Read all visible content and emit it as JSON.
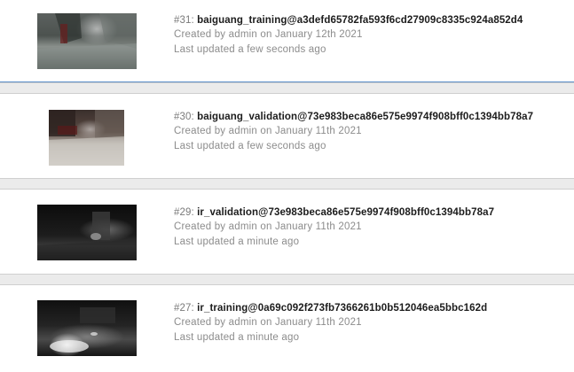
{
  "jobs": [
    {
      "number": "#31:",
      "name": "baiguang_training@a3defd65782fa593f6cd27909c8335c924a852d4",
      "created": "Created by admin on January 12th 2021",
      "updated": "Last updated a few seconds ago",
      "thumbnail_icon": "robot-camera-frame-hallway"
    },
    {
      "number": "#30:",
      "name": "baiguang_validation@73e983beca86e575e9974f908bff0c1394bb78a7",
      "created": "Created by admin on January 11th 2021",
      "updated": "Last updated a few seconds ago",
      "thumbnail_icon": "robot-camera-frame-room"
    },
    {
      "number": "#29:",
      "name": "ir_validation@73e983beca86e575e9974f908bff0c1394bb78a7",
      "created": "Created by admin on January 11th 2021",
      "updated": "Last updated a minute ago",
      "thumbnail_icon": "infrared-camera-frame"
    },
    {
      "number": "#27:",
      "name": "ir_training@0a69c092f273fb7366261b0b512046ea5bbc162d",
      "created": "Created by admin on January 11th 2021",
      "updated": "Last updated a minute ago",
      "thumbnail_icon": "infrared-camera-frame"
    }
  ],
  "colors": {
    "divider_background": "#ebebeb",
    "active_border": "#5b8fc9",
    "meta_text": "#8c8c8c"
  }
}
